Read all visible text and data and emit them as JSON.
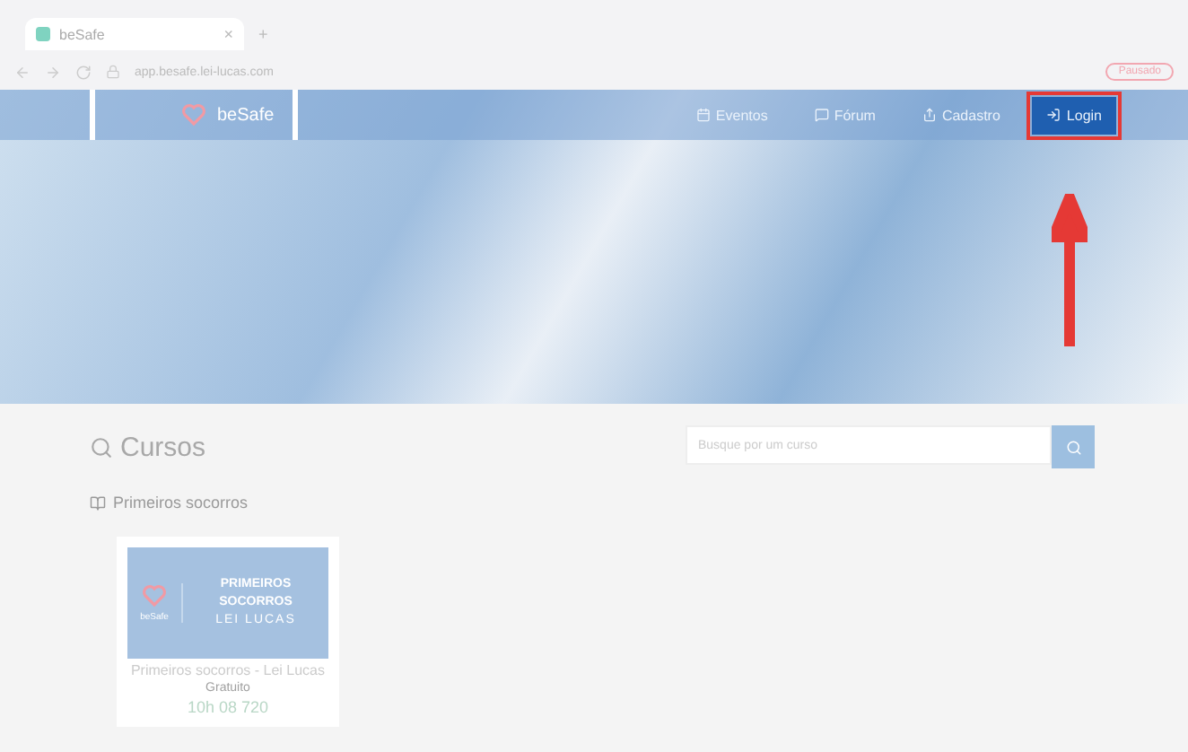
{
  "browser": {
    "tab_title": "beSafe",
    "tab_close": "×",
    "new_tab": "+",
    "url": "app.besafe.lei-lucas.com",
    "profile_button": "Pausado"
  },
  "navbar": {
    "brand": "beSafe",
    "links": [
      {
        "label": "Eventos",
        "kind": "calendar",
        "selected": false
      },
      {
        "label": "Fórum",
        "kind": "chat",
        "selected": false
      },
      {
        "label": "Cadastro",
        "kind": "share",
        "selected": false
      },
      {
        "label": "Login",
        "kind": "login",
        "selected": true
      }
    ]
  },
  "courses": {
    "title": "Cursos",
    "search_placeholder": "Busque por um curso",
    "category": "Primeiros socorros",
    "cards": [
      {
        "banner_lines": [
          "PRIMEIROS",
          "SOCORROS",
          "LEI LUCAS"
        ],
        "logo_label": "beSafe",
        "title": "Primeiros socorros - Lei Lucas",
        "subtitle": "Gratuito",
        "hours": "10h 08 720"
      }
    ]
  }
}
